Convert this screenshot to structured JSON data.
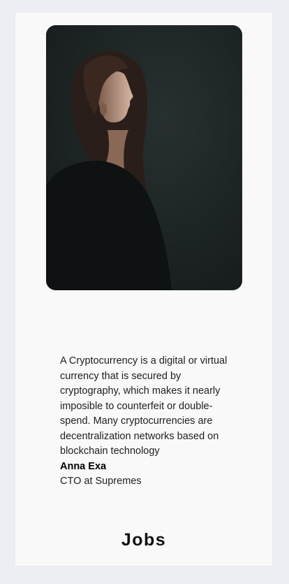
{
  "testimonial": {
    "quote": "A Cryptocurrency is a digital or virtual currency that is secured by cryptography, which makes it nearly imposible to counterfeit or double-spend. Many cryptocurrencies are decentralization networks based on blockchain technology",
    "author_name": "Anna Exa",
    "author_role": "CTO at Supremes"
  },
  "section": {
    "title": "Jobs"
  },
  "colors": {
    "page_background": "#eceef4",
    "card_background": "#f9f9f9",
    "photo_background": "#1c2222",
    "text": "#1e1e1e"
  }
}
